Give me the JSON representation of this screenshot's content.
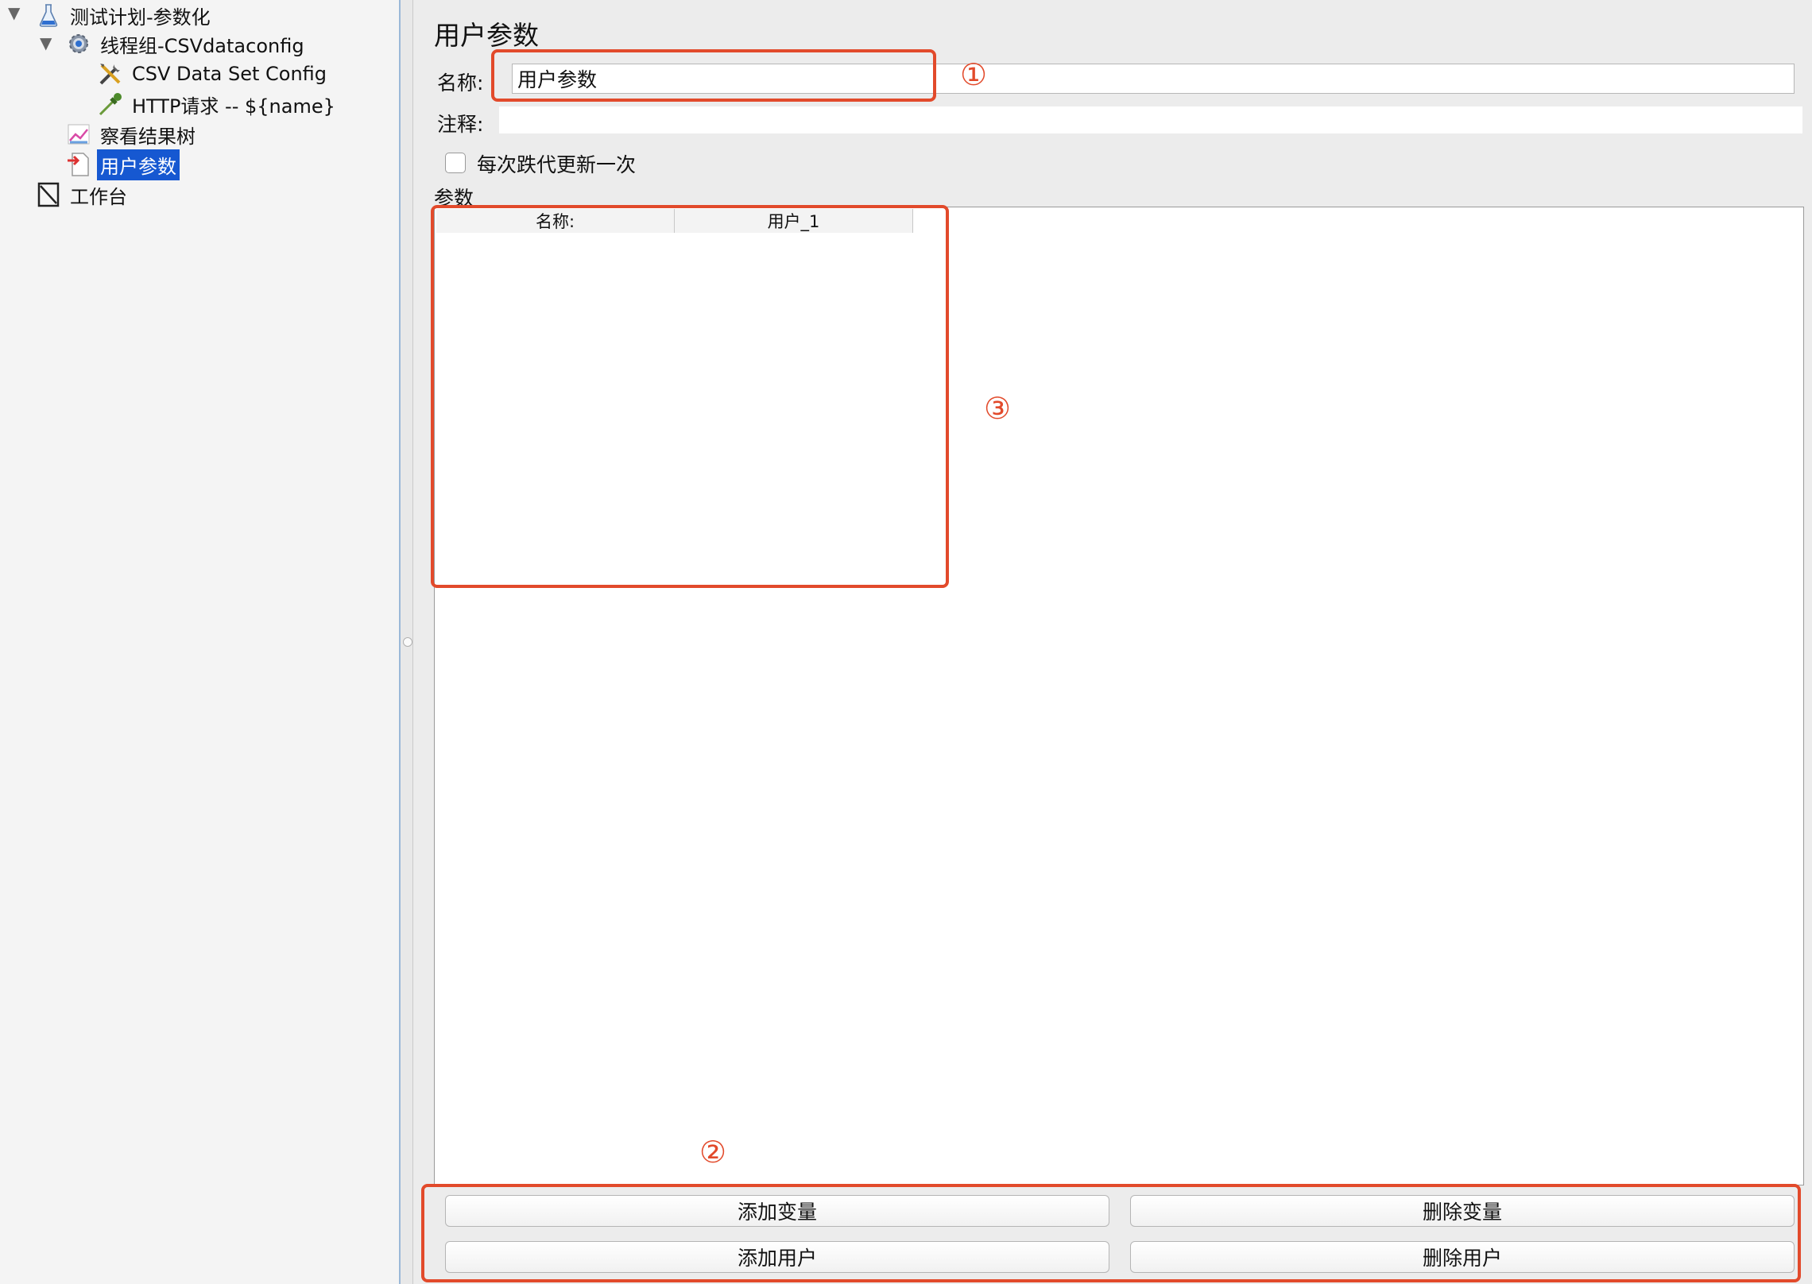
{
  "tree": [
    {
      "label": "测试计划-参数化",
      "icon": "flask-icon",
      "expanded": true
    },
    {
      "label": "线程组-CSVdataconfig",
      "icon": "gear-icon",
      "expanded": true
    },
    {
      "label": "CSV Data Set Config",
      "icon": "tools-icon"
    },
    {
      "label": "HTTP请求 -- ${name}",
      "icon": "pipette-icon"
    },
    {
      "label": "察看结果树",
      "icon": "chart-icon"
    },
    {
      "label": "用户参数",
      "icon": "document-arrow-icon",
      "selected": true
    },
    {
      "label": "工作台",
      "icon": "workbench-icon"
    }
  ],
  "panel": {
    "title": "用户参数",
    "name_label": "名称:",
    "name_value": "用户参数",
    "comment_label": "注释:",
    "checkbox_label": "每次跌代更新一次",
    "checkbox_checked": false,
    "params_label": "参数",
    "table_headers": [
      "名称:",
      "用户_1"
    ]
  },
  "buttons": {
    "add_variable": "添加变量",
    "delete_variable": "删除变量",
    "add_user": "添加用户",
    "delete_user": "删除用户"
  },
  "annotations": {
    "one": "①",
    "two": "②",
    "three": "③",
    "color": "#e24a2b"
  },
  "colors": {
    "selection": "#1658d1"
  }
}
